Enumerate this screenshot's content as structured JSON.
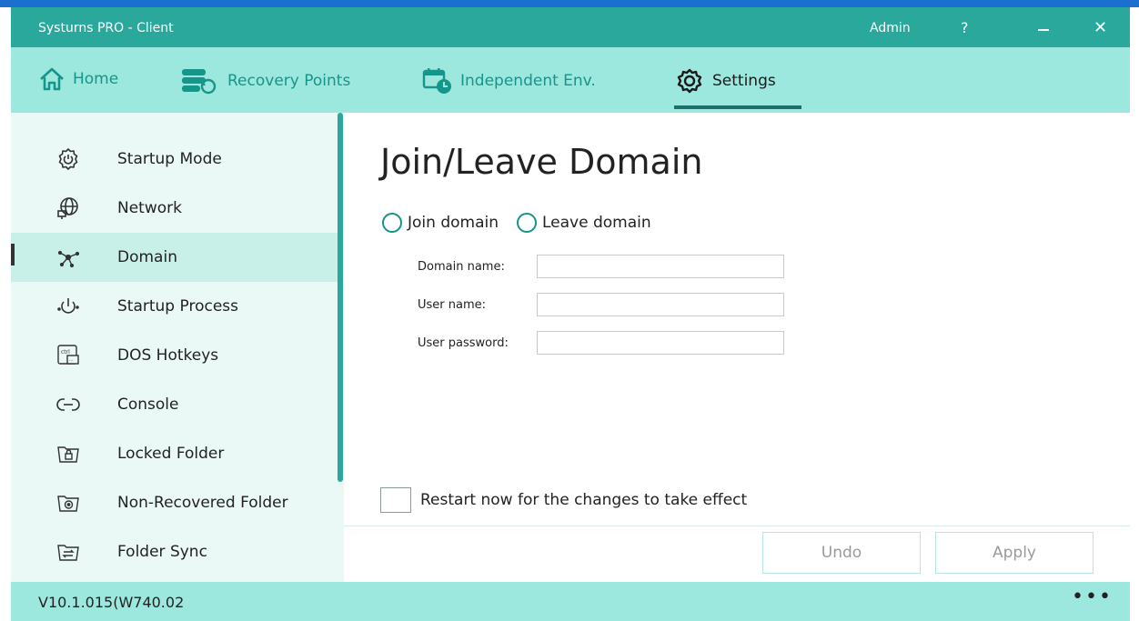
{
  "window": {
    "title": "Systurns PRO - Client",
    "user_label": "Admin",
    "help_label": "?",
    "close_label": "✕"
  },
  "nav": {
    "items": [
      {
        "label": "Home",
        "icon": "home-icon"
      },
      {
        "label": "Recovery Points",
        "icon": "recovery-points-icon"
      },
      {
        "label": "Independent Env.",
        "icon": "independent-env-icon"
      },
      {
        "label": "Settings",
        "icon": "settings-icon"
      }
    ],
    "active": "Settings"
  },
  "sidebar": {
    "items": [
      {
        "label": "Startup Mode",
        "icon": "startup-mode-icon"
      },
      {
        "label": "Network",
        "icon": "network-icon"
      },
      {
        "label": "Domain",
        "icon": "domain-icon"
      },
      {
        "label": "Startup Process",
        "icon": "startup-process-icon"
      },
      {
        "label": "DOS Hotkeys",
        "icon": "dos-hotkeys-icon"
      },
      {
        "label": "Console",
        "icon": "console-icon"
      },
      {
        "label": "Locked Folder",
        "icon": "locked-folder-icon"
      },
      {
        "label": "Non-Recovered Folder",
        "icon": "non-recovered-folder-icon"
      },
      {
        "label": "Folder Sync",
        "icon": "folder-sync-icon"
      }
    ],
    "selected": "Domain"
  },
  "main": {
    "title": "Join/Leave Domain",
    "radios": [
      {
        "label": "Join domain"
      },
      {
        "label": "Leave domain"
      }
    ],
    "fields": [
      {
        "label": "Domain name:",
        "value": ""
      },
      {
        "label": "User name:",
        "value": ""
      },
      {
        "label": "User password:",
        "value": ""
      }
    ],
    "restart_label": "Restart now for the changes to take effect",
    "undo_label": "Undo",
    "apply_label": "Apply"
  },
  "status": {
    "version": "V10.1.015(W740.02",
    "more_label": "•••"
  },
  "colors": {
    "accent": "#2aa89c",
    "nav_background": "#9de8de",
    "sidebar_background": "#eaf8f6",
    "sidebar_selected": "#c9efe9"
  }
}
